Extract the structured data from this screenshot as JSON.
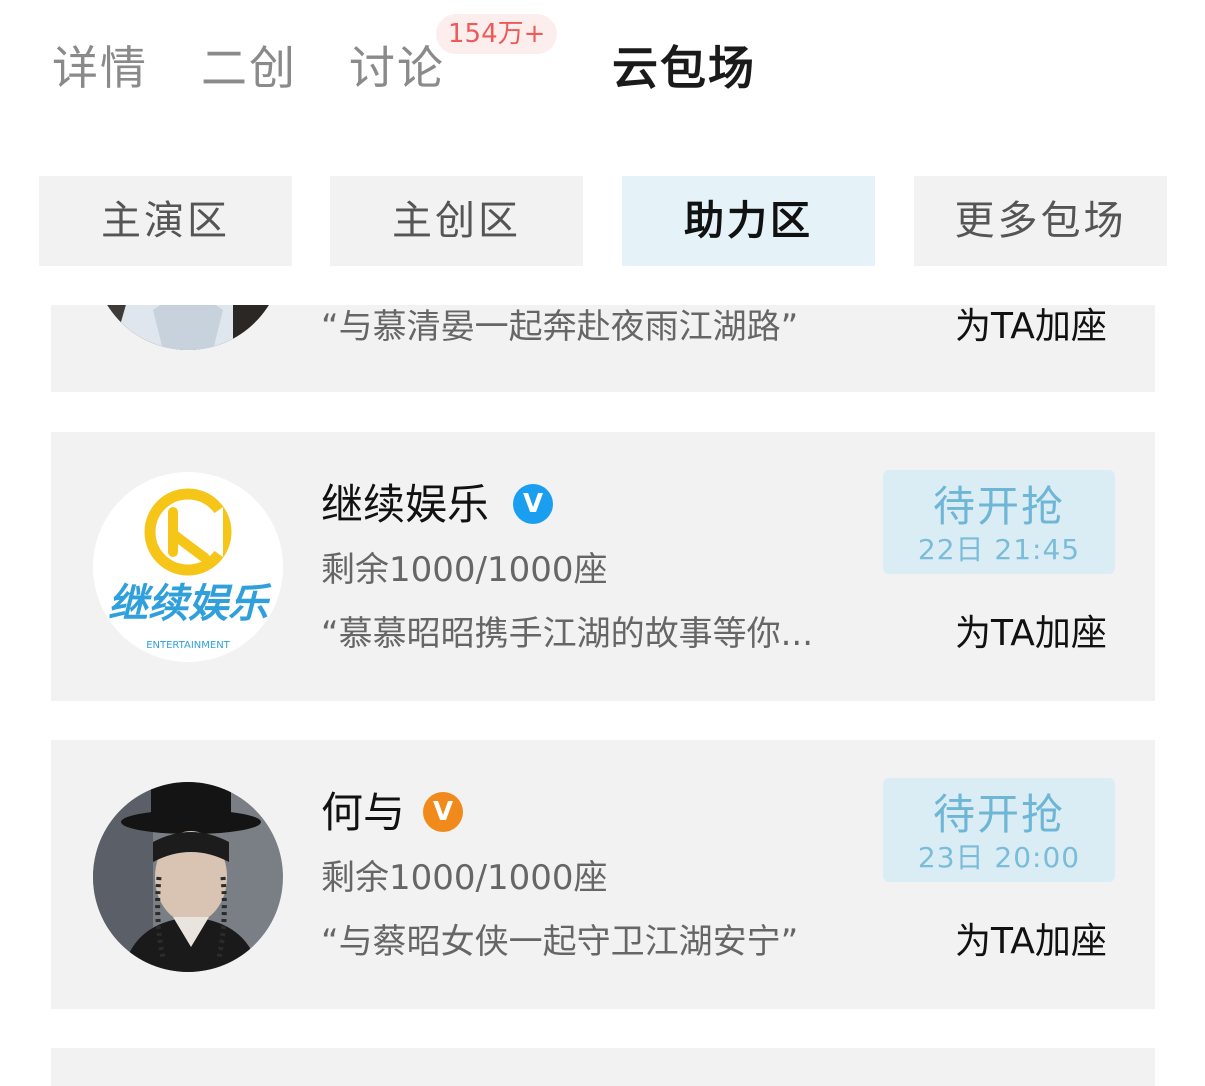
{
  "top_tabs": {
    "details": "详情",
    "secondary_creation": "二创",
    "discussion": "讨论",
    "discussion_count": "154万+",
    "cloud_screening": "云包场"
  },
  "segments": [
    "主演区",
    "主创区",
    "助力区",
    "更多包场"
  ],
  "active_segment": "助力区",
  "cards": [
    {
      "name": "",
      "quote": "“与慕清晏一起奔赴夜雨江湖路”",
      "add_seat": "为TA加座"
    },
    {
      "name": "继续娱乐",
      "verify_color": "#1a9ff0",
      "seats": "剩余1000/1000座",
      "quote": "“慕慕昭昭携手江湖的故事等你...",
      "grab_label": "待开抢",
      "grab_time": "22日 21:45",
      "add_seat": "为TA加座",
      "logo_text": "继续娱乐",
      "logo_sub": "ENTERTAINMENT"
    },
    {
      "name": "何与",
      "verify_color": "#f08a1a",
      "seats": "剩余1000/1000座",
      "quote": "“与蔡昭女侠一起守卫江湖安宁”",
      "grab_label": "待开抢",
      "grab_time": "23日 20:00",
      "add_seat": "为TA加座"
    }
  ],
  "colors": {
    "card_bg": "#f2f2f2",
    "active_segment_bg": "#e5f3f9",
    "grab_button_bg": "#daedf5",
    "grab_text": "#6fb6d6",
    "badge_text": "#ee5a5a"
  }
}
